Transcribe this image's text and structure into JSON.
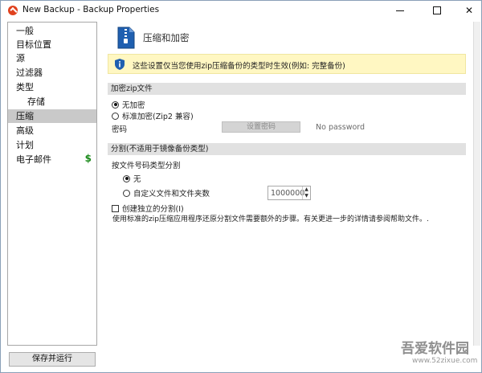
{
  "window": {
    "title": "New Backup - Backup Properties"
  },
  "nav": {
    "items": [
      {
        "label": "一般"
      },
      {
        "label": "目标位置"
      },
      {
        "label": "源"
      },
      {
        "label": "过滤器"
      },
      {
        "label": "类型"
      },
      {
        "label": "存储"
      },
      {
        "label": "压缩"
      },
      {
        "label": "高级"
      },
      {
        "label": "计划"
      },
      {
        "label": "电子邮件"
      }
    ],
    "selected": "压缩",
    "dollar_symbol": "$"
  },
  "footer": {
    "save_run_label": "保存并运行"
  },
  "content": {
    "title": "压缩和加密",
    "info_banner": "这些设置仅当您使用zip压缩备份的类型时生效(例如: 完整备份)",
    "encryption": {
      "section_label": "加密zip文件",
      "option_none": "无加密",
      "option_standard": "标准加密(Zip2 兼容)",
      "password_label": "密码",
      "set_password_button": "设置密码",
      "password_status": "No password"
    },
    "split": {
      "section_label": "分割(不适用于镜像备份类型)",
      "by_type_label": "按文件号码类型分割",
      "option_none": "无",
      "option_custom": "自定义文件和文件夹数",
      "custom_value": "1000000",
      "create_independent_label": "创建独立的分割(I)",
      "description": "使用标准的zip压缩应用程序还原分割文件需要额外的步骤。有关更进一步的详情请参阅帮助文件。."
    }
  },
  "watermark": {
    "main": "吾爱软件园",
    "sub": "www.52zixue.com"
  },
  "colors": {
    "banner_bg": "#fff7c2",
    "selected_bg": "#c9c9c9",
    "section_bg": "#e1e1e1",
    "accent_icon": "#1f5fb0",
    "app_icon": "#e0421f"
  }
}
